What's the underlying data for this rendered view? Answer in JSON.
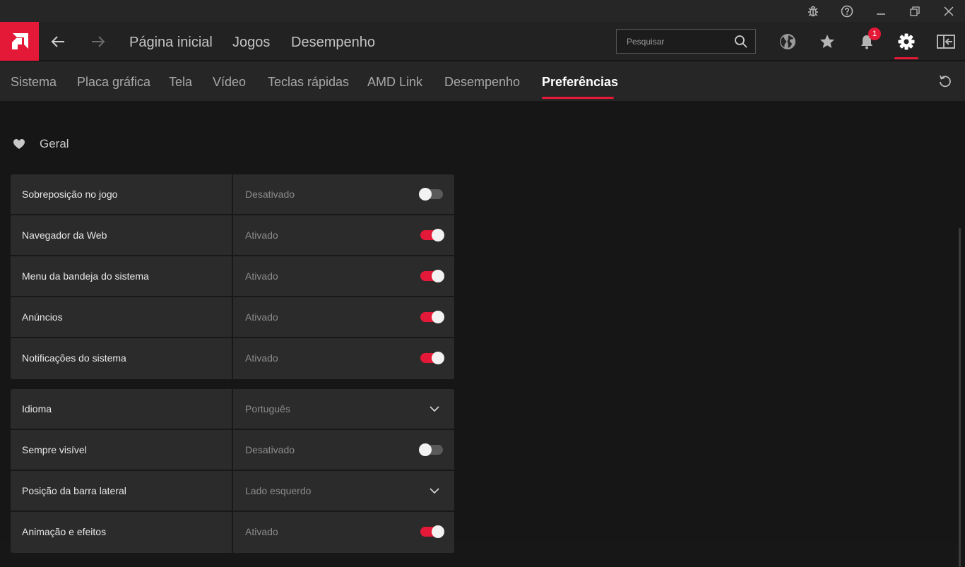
{
  "colors": {
    "accent": "#e31937",
    "background": "#161616",
    "card": "#2b2b2b"
  },
  "window_controls": [
    "bug-icon",
    "help-icon",
    "minimize-icon",
    "restore-icon",
    "close-icon"
  ],
  "nav": {
    "main_links": [
      "Página inicial",
      "Jogos",
      "Desempenho"
    ],
    "search_placeholder": "Pesquisar",
    "notification_count": "1"
  },
  "subnav": {
    "tabs": [
      "Sistema",
      "Placa gráfica",
      "Tela",
      "Vídeo",
      "Teclas rápidas",
      "AMD Link",
      "Desempenho",
      "Preferências"
    ],
    "active_tab": "Preferências"
  },
  "section": {
    "title": "Geral",
    "icon": "heart-icon"
  },
  "group1": [
    {
      "label": "Sobreposição no jogo",
      "value": "Desativado",
      "control": "toggle",
      "on": false
    },
    {
      "label": "Navegador da Web",
      "value": "Ativado",
      "control": "toggle",
      "on": true
    },
    {
      "label": "Menu da bandeja do sistema",
      "value": "Ativado",
      "control": "toggle",
      "on": true
    },
    {
      "label": "Anúncios",
      "value": "Ativado",
      "control": "toggle",
      "on": true
    },
    {
      "label": "Notificações do sistema",
      "value": "Ativado",
      "control": "toggle",
      "on": true
    }
  ],
  "group2": [
    {
      "label": "Idioma",
      "value": "Português",
      "control": "dropdown"
    },
    {
      "label": "Sempre visível",
      "value": "Desativado",
      "control": "toggle",
      "on": false
    },
    {
      "label": "Posição da barra lateral",
      "value": "Lado esquerdo",
      "control": "dropdown"
    },
    {
      "label": "Animação e efeitos",
      "value": "Ativado",
      "control": "toggle",
      "on": true
    }
  ]
}
